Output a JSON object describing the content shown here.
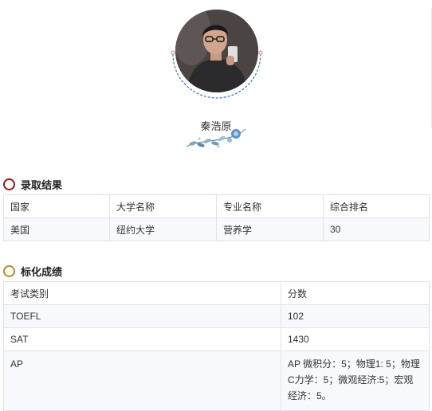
{
  "profile": {
    "name": "秦浩原"
  },
  "admission": {
    "title": "录取结果",
    "columns": [
      "国家",
      "大学名称",
      "专业名称",
      "综合排名"
    ],
    "rows": [
      [
        "美国",
        "纽约大学",
        "营养学",
        "30"
      ]
    ]
  },
  "scores": {
    "title": "标化成绩",
    "columns": [
      "考试类别",
      "分数"
    ],
    "rows": [
      [
        "TOEFL",
        "102"
      ],
      [
        "SAT",
        "1430"
      ],
      [
        "AP",
        "AP 微积分：5；物理1: 5；物理C力学：5；微观经济:5；宏观经济：5。"
      ]
    ]
  },
  "colors": {
    "admission_ring": "#8b1a1a",
    "scores_ring": "#b58a2c",
    "table_border": "#dfe3ea",
    "row_tint": "#f7f9fc"
  }
}
